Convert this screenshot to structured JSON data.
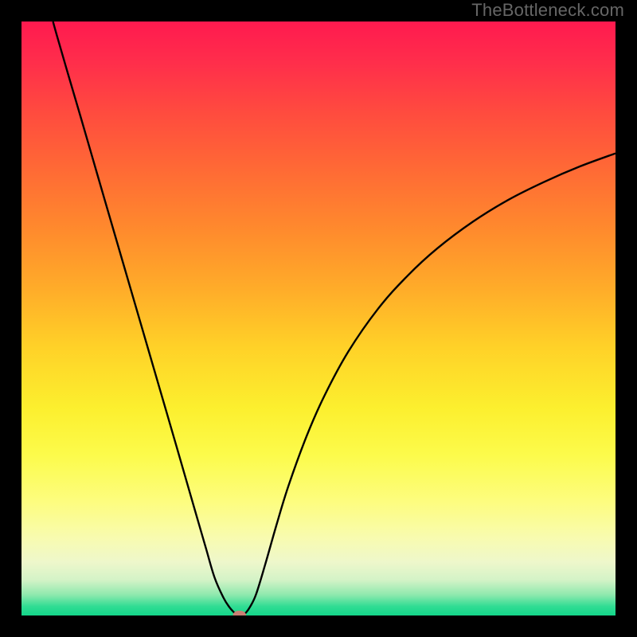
{
  "watermark": "TheBottleneck.com",
  "colors": {
    "border": "#000000",
    "curve": "#000000",
    "marker": "#c98074",
    "gradient_stops": [
      {
        "offset": 0.0,
        "color": "#ff1a4f"
      },
      {
        "offset": 0.07,
        "color": "#ff2e4b"
      },
      {
        "offset": 0.15,
        "color": "#ff4a3f"
      },
      {
        "offset": 0.25,
        "color": "#ff6a35"
      },
      {
        "offset": 0.35,
        "color": "#ff8a2d"
      },
      {
        "offset": 0.45,
        "color": "#ffac29"
      },
      {
        "offset": 0.55,
        "color": "#ffd228"
      },
      {
        "offset": 0.65,
        "color": "#fcef2e"
      },
      {
        "offset": 0.73,
        "color": "#fcfb4b"
      },
      {
        "offset": 0.81,
        "color": "#fdfd80"
      },
      {
        "offset": 0.87,
        "color": "#f8fbb0"
      },
      {
        "offset": 0.91,
        "color": "#eef7cb"
      },
      {
        "offset": 0.94,
        "color": "#d4f3c7"
      },
      {
        "offset": 0.965,
        "color": "#8fe9ae"
      },
      {
        "offset": 0.985,
        "color": "#2fdc93"
      },
      {
        "offset": 1.0,
        "color": "#14d68a"
      }
    ]
  },
  "chart_data": {
    "type": "line",
    "title": "",
    "xlabel": "",
    "ylabel": "",
    "xlim": [
      0,
      100
    ],
    "ylim": [
      0,
      100
    ],
    "grid": false,
    "series": [
      {
        "name": "curve",
        "x": [
          5.3,
          6,
          8,
          10,
          12,
          14,
          17,
          20,
          23,
          26,
          29,
          31,
          32.5,
          34,
          35,
          35.8,
          36.2,
          36.5,
          36.9,
          37.3,
          37.8,
          38.5,
          39.5,
          41,
          43,
          45,
          48,
          51,
          55,
          60,
          65,
          70,
          76,
          82,
          88,
          94,
          100
        ],
        "y": [
          100,
          97.5,
          90.6,
          83.8,
          76.9,
          70,
          59.7,
          49.4,
          39.1,
          28.8,
          18.4,
          11.5,
          6.4,
          3,
          1.4,
          0.5,
          0.15,
          0.07,
          0.07,
          0.15,
          0.5,
          1.5,
          3.6,
          8.5,
          15.5,
          22,
          30.2,
          37,
          44.4,
          51.6,
          57.2,
          61.8,
          66.3,
          70,
          73,
          75.6,
          77.8
        ]
      }
    ],
    "marker": {
      "x": 36.7,
      "y": 0.07,
      "rx": 1.1,
      "ry": 0.75
    },
    "annotations": []
  }
}
